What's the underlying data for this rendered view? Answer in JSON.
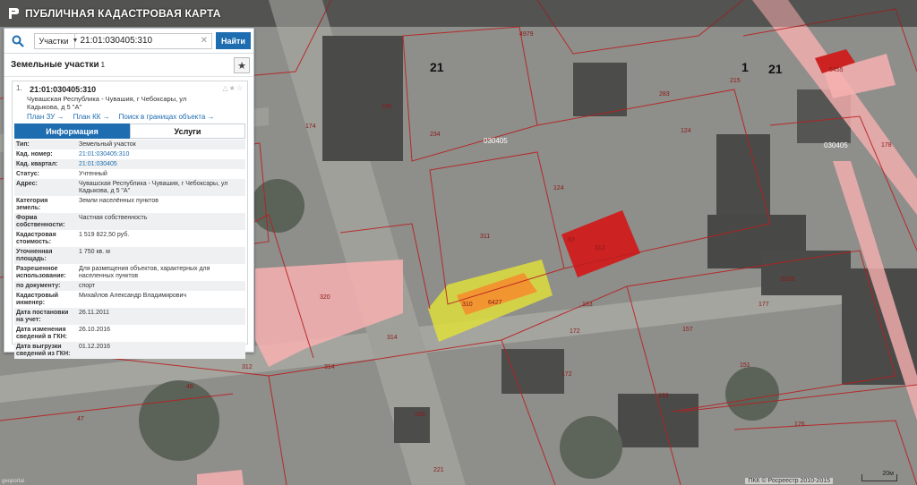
{
  "app": {
    "title": "ПУБЛИЧНАЯ КАДАСТРОВАЯ КАРТА"
  },
  "search": {
    "type_label": "Участки",
    "query": "21:01:030405:310",
    "find_label": "Найти"
  },
  "list": {
    "title": "Земельные участки",
    "count": "1"
  },
  "item": {
    "index": "1.",
    "cad_number": "21:01:030405:310",
    "address": "Чувашская Республика - Чувашия, г Чебоксары, ул Кадыкова, д 5 \"А\"",
    "links": [
      "План ЗУ →",
      "План КК →",
      "Поиск в границах объекта →"
    ]
  },
  "tabs": [
    {
      "label": "Информация"
    },
    {
      "label": "Услуги"
    }
  ],
  "attributes": [
    {
      "key": "Тип:",
      "value": "Земельный участок"
    },
    {
      "key": "Кад. номер:",
      "value": "21:01:030405:310"
    },
    {
      "key": "Кад. квартал:",
      "value": "21:01:030405"
    },
    {
      "key": "Статус:",
      "value": "Учтенный"
    },
    {
      "key": "Адрес:",
      "value": "Чувашская Республика - Чувашия, г Чебоксары, ул Кадыкова, д 5 \"А\""
    },
    {
      "key": "Категория земель:",
      "value": "Земли населённых пунктов"
    },
    {
      "key": "Форма собственности:",
      "value": "Частная собственность"
    },
    {
      "key": "Кадастровая стоимость:",
      "value": "1 519 822,50 руб."
    },
    {
      "key": "Уточненная площадь:",
      "value": "1 750 кв. м"
    },
    {
      "key": "Разрешенное использование:",
      "value": "Для размещения объектов, характерных для населенных пунктов"
    },
    {
      "key": "по документу:",
      "value": "спорт"
    },
    {
      "key": "Кадастровый инженер:",
      "value": "Михайлов Александр Владимирович"
    },
    {
      "key": "Дата постановки на учет:",
      "value": "26.11.2011"
    },
    {
      "key": "Дата изменения сведений в ГКН:",
      "value": "26.10.2016"
    },
    {
      "key": "Дата выгрузки сведений из ГКН:",
      "value": "01.12.2016"
    }
  ],
  "map": {
    "district_labels": [
      "1",
      "21",
      "1",
      "21"
    ],
    "quarter_labels": [
      "030405",
      "030405"
    ],
    "parcel_labels": [
      "310",
      "6427",
      "312",
      "63",
      "320",
      "311",
      "124",
      "183",
      "234",
      "177",
      "166"
    ],
    "colors": {
      "selected": "#e0e040",
      "building": "#f08a2a",
      "red_parcel": "#cc2222",
      "pink": "#f7b0b0",
      "boundary": "#b82020"
    }
  },
  "footer": {
    "copyright": "ПКК © Росреестр 2010-2015",
    "scale": "20м",
    "attribution": "geoportal"
  }
}
